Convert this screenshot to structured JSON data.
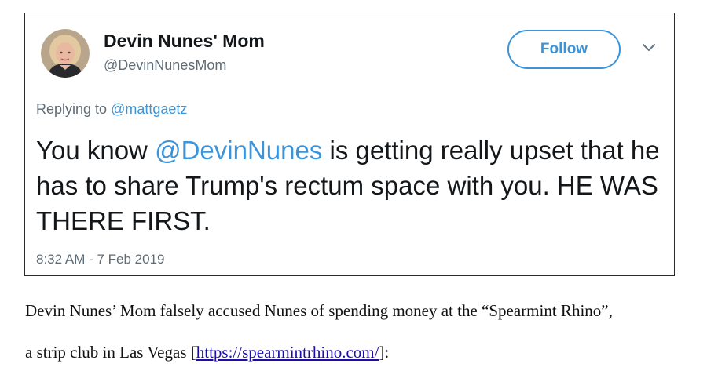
{
  "tweet": {
    "display_name": "Devin Nunes' Mom",
    "handle": "@DevinNunesMom",
    "follow_label": "Follow",
    "reply_prefix": "Replying to",
    "reply_to": "@mattgaetz",
    "text_before_mention": "You know",
    "mention": "@DevinNunes",
    "text_after_mention": "is getting really upset that he has to share Trump's rectum space with you. HE WAS THERE FIRST.",
    "timestamp": "8:32 AM - 7 Feb 2019"
  },
  "caption": {
    "line1": "Devin Nunes’ Mom falsely accused Nunes of spending money at the “Spearmint Rhino”,",
    "line2_before_link": "a strip club in Las Vegas [",
    "link_text": "https://spearmintrhino.com/",
    "line2_after_link": "]:"
  },
  "colors": {
    "accent": "#3b94d9",
    "secondary_text": "#5f6b75",
    "primary_text": "#14171a",
    "link": "#1a0dab"
  },
  "icons": {
    "avatar": "profile-photo",
    "menu": "chevron-down-icon"
  }
}
